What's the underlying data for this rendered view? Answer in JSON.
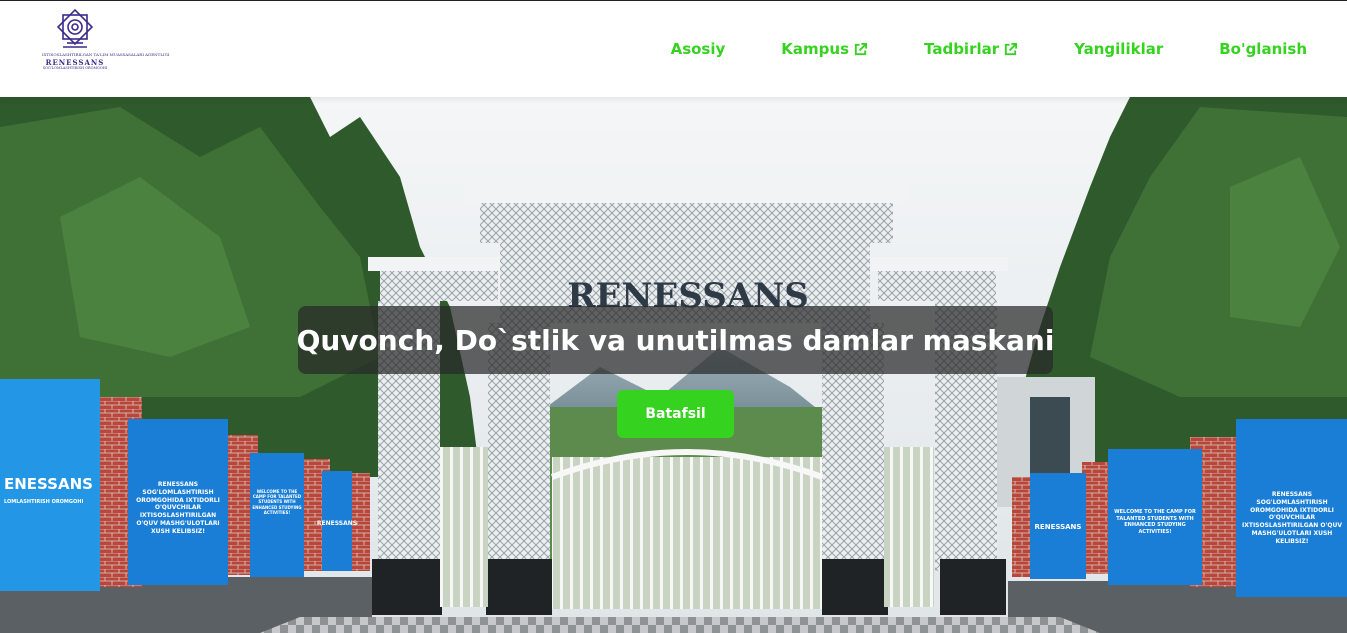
{
  "brand": {
    "logo_top_text": "IXTISOSLASHTIRILGAN TA'LIM MUASSASALARI AGENTLIGI",
    "logo_name": "RENESSANS",
    "logo_sub": "SOG'LOMLASHTIRISH OROMGOHI",
    "colors": {
      "accent": "#35d320",
      "logo": "#3c2a8c"
    }
  },
  "nav": {
    "items": [
      {
        "label": "Asosiy",
        "external": false
      },
      {
        "label": "Kampus",
        "external": true
      },
      {
        "label": "Tadbirlar",
        "external": true
      },
      {
        "label": "Yangiliklar",
        "external": false
      },
      {
        "label": "Bo'glanish",
        "external": false
      }
    ]
  },
  "hero": {
    "headline": "Quvonch, Do`stlik va unutilmas damlar maskani",
    "cta_label": "Batafsil",
    "gate_sign": "RENESSANS",
    "banners": {
      "left_1": "ENESSANS",
      "left_1_sub": "LOMLASHTIRISH OROMGOHI",
      "left_2": "RENESSANS SOG'LOMLASHTIRISH OROMGOHIDA IXTIDORLI O'QUVCHILAR IXTISOSLASHTIRILGAN O'QUV MASHG'ULOTLARI XUSH KELIBSIZ!",
      "left_3": "WELCOME TO THE CAMP FOR TALANTED STUDENTS WITH ENHANCED STUDYING ACTIVITIES!",
      "left_4": "RENESSANS",
      "right_1": "RENESSANS",
      "right_2": "WELCOME TO THE CAMP FOR TALANTED STUDENTS WITH ENHANCED STUDYING ACTIVITIES!",
      "right_3": "RENESSANS SOG'LOMLASHTIRISH OROMGOHIDA IXTIDORLI O'QUVCHILAR IXTISOSLASHTIRILGAN O'QUV MASHG'ULOTLARI XUSH KELIBSIZ!"
    }
  }
}
